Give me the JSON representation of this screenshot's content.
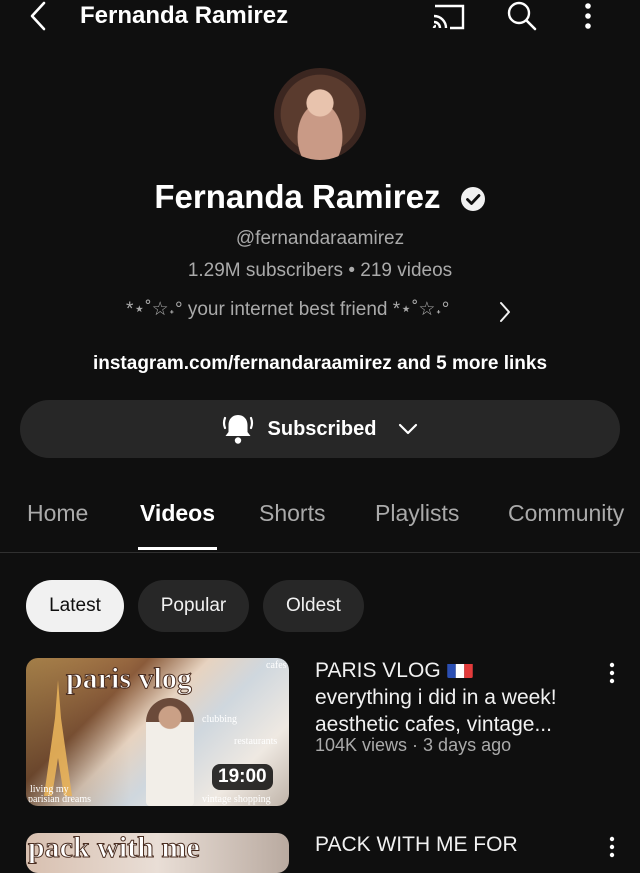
{
  "header": {
    "title": "Fernanda Ramirez",
    "icons": [
      "back-icon",
      "cast-icon",
      "search-icon",
      "more-icon"
    ]
  },
  "channel": {
    "name": "Fernanda Ramirez",
    "handle": "@fernandaraamirez",
    "stats": "1.29M subscribers • 219 videos",
    "bio": "*⋆˚☆˖°  your internet best friend *⋆˚☆˖°",
    "links": "instagram.com/fernandaraamirez and 5 more links"
  },
  "subscribe": {
    "label": "Subscribed"
  },
  "tabs": [
    "Home",
    "Videos",
    "Shorts",
    "Playlists",
    "Community"
  ],
  "active_tab": "Videos",
  "chips": [
    "Latest",
    "Popular",
    "Oldest"
  ],
  "active_chip": "Latest",
  "videos": [
    {
      "title_line1": "PARIS VLOG",
      "title_rest": "everything i did in a week! aesthetic cafes, vintage...",
      "meta": "104K views · 3 days ago",
      "duration": "19:00",
      "thumb_text": {
        "title": "paris vlog",
        "cafes": "cafes",
        "clubbing": "clubbing",
        "restaurants": "restaurants",
        "living": "living my",
        "dreams": "parisian dreams",
        "vintage": "vintage shopping"
      }
    },
    {
      "title_line1": "PACK WITH ME FOR",
      "thumb_text": {
        "title": "pack with me"
      }
    }
  ],
  "colors": {
    "background": "#0f0f0f",
    "chip": "#272727",
    "secondary_text": "#aaaaaa"
  }
}
